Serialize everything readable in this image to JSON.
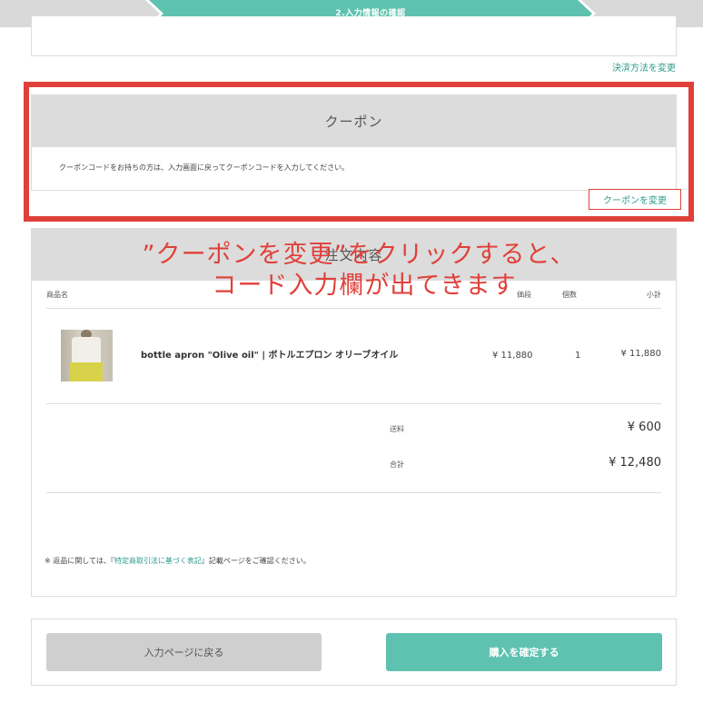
{
  "steps": {
    "current": "2.入力情報の確認"
  },
  "payment": {
    "change_link": "決済方法を変更"
  },
  "coupon": {
    "title": "クーポン",
    "message": "クーポンコードをお持ちの方は、入力画面に戻ってクーポンコードを入力してください。",
    "change_link": "クーポンを変更"
  },
  "order": {
    "title": "注文内容",
    "columns": {
      "product": "商品名",
      "price": "価段",
      "qty": "個数",
      "subtotal": "小計"
    },
    "items": [
      {
        "name": "bottle apron \"Olive oil\" | ボトルエプロン オリーブオイル",
        "price": "¥ 11,880",
        "qty": "1",
        "subtotal": "¥ 11,880"
      }
    ],
    "shipping_label": "送料",
    "shipping_value": "¥ 600",
    "total_label": "合計",
    "total_value": "¥ 12,480",
    "return_note_prefix": "※ 返品に関しては、『",
    "return_note_link": "特定商取引法に基づく表記",
    "return_note_suffix": "』記載ページをご確認ください。"
  },
  "actions": {
    "back_label": "入力ページに戻る",
    "confirm_label": "購入を確定する"
  },
  "annotation": {
    "line1": "”クーポンを変更”をクリックすると、",
    "line2": "コード入力欄が出てきます"
  },
  "colors": {
    "accent": "#5fc2b0",
    "link": "#2f9c8c",
    "highlight": "#e0403a"
  }
}
